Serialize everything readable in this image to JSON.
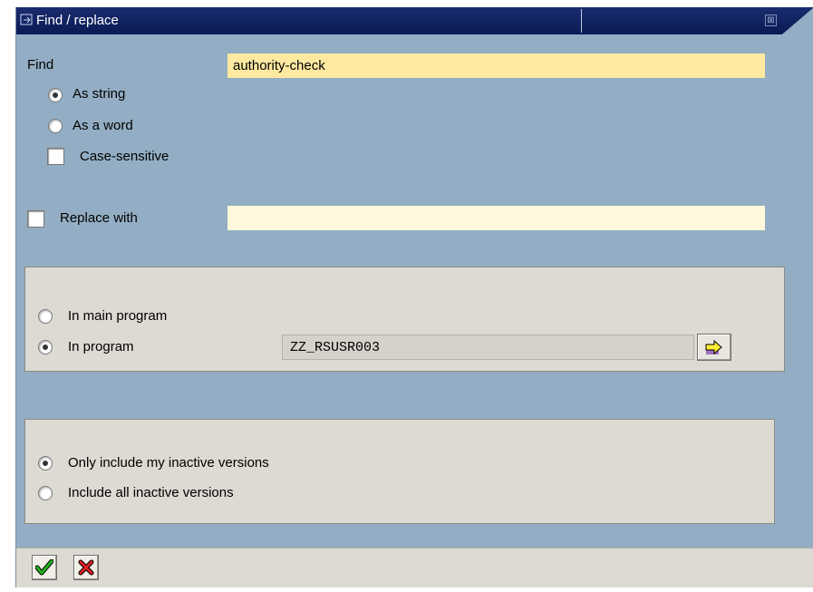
{
  "window": {
    "title": "Find / replace"
  },
  "find": {
    "label": "Find",
    "value": "authority-check"
  },
  "options": {
    "as_string": "As string",
    "as_word": "As a word",
    "case_sensitive": "Case-sensitive"
  },
  "replace": {
    "label": "Replace with",
    "value": ""
  },
  "scope": {
    "main_program": "In main program",
    "in_program": "In program",
    "program_name": "ZZ_RSUSR003"
  },
  "versions": {
    "only_mine": "Only include my inactive versions",
    "all": "Include all inactive versions"
  },
  "colors": {
    "find_field": "#ffe9a1",
    "replace_field": "#fff8dc",
    "dialog_bg": "#93aec4",
    "panel_bg": "#dcdad2",
    "title_bar": "#0f2160"
  }
}
